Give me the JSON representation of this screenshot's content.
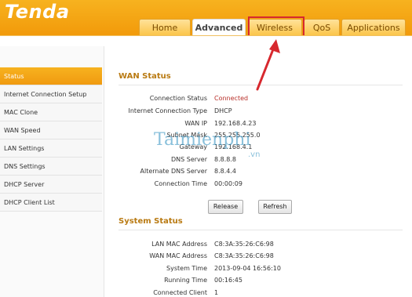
{
  "brand": {
    "logo": "Tenda"
  },
  "tabs": [
    {
      "label": "Home",
      "active": false
    },
    {
      "label": "Advanced",
      "active": true
    },
    {
      "label": "Wireless",
      "active": false
    },
    {
      "label": "QoS",
      "active": false
    },
    {
      "label": "Applications",
      "active": false
    }
  ],
  "sidebar": {
    "items": [
      {
        "label": "Status",
        "active": true
      },
      {
        "label": "Internet Connection Setup",
        "active": false
      },
      {
        "label": "MAC Clone",
        "active": false
      },
      {
        "label": "WAN Speed",
        "active": false
      },
      {
        "label": "LAN Settings",
        "active": false
      },
      {
        "label": "DNS Settings",
        "active": false
      },
      {
        "label": "DHCP Server",
        "active": false
      },
      {
        "label": "DHCP Client List",
        "active": false
      }
    ]
  },
  "wan": {
    "title": "WAN Status",
    "rows": [
      {
        "label": "Connection Status",
        "value": "Connected"
      },
      {
        "label": "Internet Connection Type",
        "value": "DHCP"
      },
      {
        "label": "WAN IP",
        "value": "192.168.4.23"
      },
      {
        "label": "Subnet Mask",
        "value": "255.255.255.0"
      },
      {
        "label": "Gateway",
        "value": "192.168.4.1"
      },
      {
        "label": "DNS Server",
        "value": "8.8.8.8"
      },
      {
        "label": "Alternate DNS Server",
        "value": "8.8.4.4"
      },
      {
        "label": "Connection Time",
        "value": "00:00:09"
      }
    ],
    "release_label": "Release",
    "refresh_label": "Refresh"
  },
  "system": {
    "title": "System Status",
    "rows": [
      {
        "label": "LAN MAC Address",
        "value": "C8:3A:35:26:C6:98"
      },
      {
        "label": "WAN MAC Address",
        "value": "C8:3A:35:26:C6:98"
      },
      {
        "label": "System Time",
        "value": "2013-09-04 16:56:10"
      },
      {
        "label": "Running Time",
        "value": "00:16:45"
      },
      {
        "label": "Connected Client",
        "value": "1"
      }
    ]
  },
  "watermark": {
    "text": "Taimienphi",
    "suffix": ".vn"
  },
  "colors": {
    "accent": "#f29a0a",
    "highlight": "#d7282e",
    "section_title": "#b97a12",
    "connected": "#b8302a"
  }
}
